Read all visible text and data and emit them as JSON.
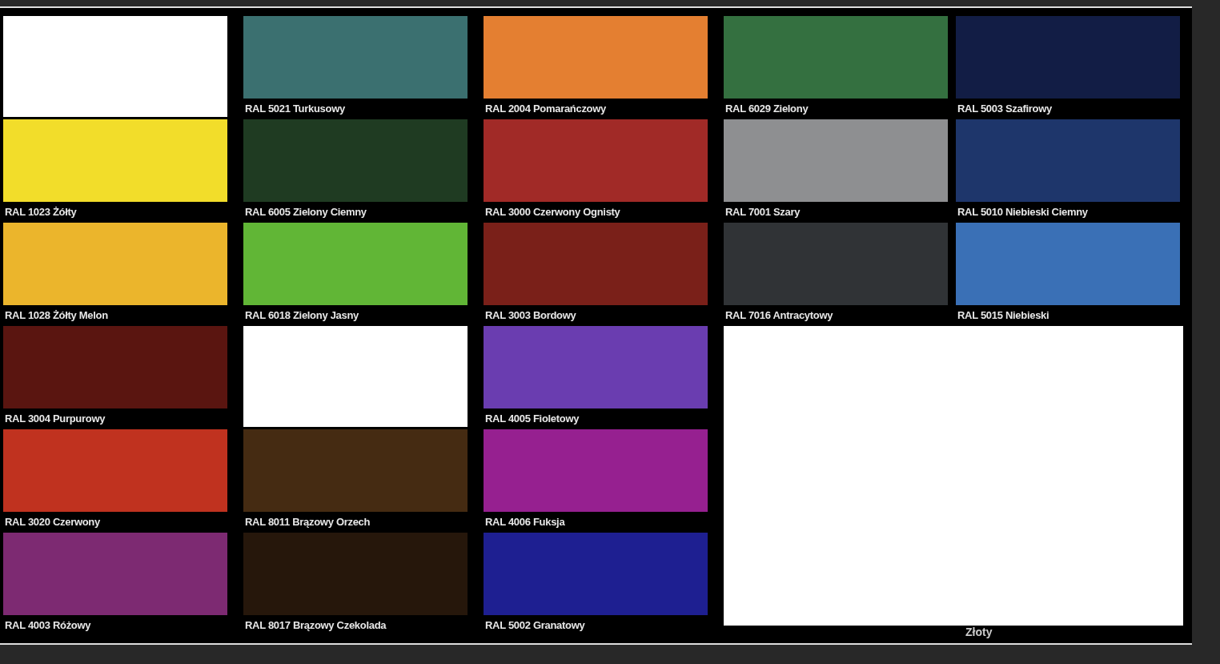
{
  "left_columns": [
    [
      {
        "kind": "blank"
      },
      {
        "kind": "swatch",
        "label": "RAL 1023 Żółty",
        "color": "#f2dd2a"
      },
      {
        "kind": "swatch",
        "label": "RAL 1028 Żółty Melon",
        "color": "#ebb52c"
      },
      {
        "kind": "swatch",
        "label": "RAL 3004 Purpurowy",
        "color": "#5a1510"
      },
      {
        "kind": "swatch",
        "label": "RAL 3020 Czerwony",
        "color": "#c0321f"
      },
      {
        "kind": "swatch",
        "label": "RAL 4003 Różowy",
        "color": "#7d2a72"
      }
    ],
    [
      {
        "kind": "swatch",
        "label": "RAL 5021 Turkusowy",
        "color": "#3b7070"
      },
      {
        "kind": "swatch",
        "label": "RAL 6005 Zielony Ciemny",
        "color": "#1f3b22"
      },
      {
        "kind": "swatch",
        "label": "RAL 6018 Zielony Jasny",
        "color": "#61b636"
      },
      {
        "kind": "blank"
      },
      {
        "kind": "swatch",
        "label": "RAL 8011 Brązowy Orzech",
        "color": "#452b12"
      },
      {
        "kind": "swatch",
        "label": "RAL 8017 Brązowy Czekolada",
        "color": "#26170b"
      }
    ],
    [
      {
        "kind": "swatch",
        "label": "RAL 2004 Pomarańczowy",
        "color": "#e47f31"
      },
      {
        "kind": "swatch",
        "label": "RAL 3000 Czerwony Ognisty",
        "color": "#a12a27"
      },
      {
        "kind": "swatch",
        "label": "RAL 3003 Bordowy",
        "color": "#7a2019"
      },
      {
        "kind": "swatch",
        "label": "RAL 4005 Fioletowy",
        "color": "#6a3db0"
      },
      {
        "kind": "swatch",
        "label": "RAL 4006 Fuksja",
        "color": "#962090"
      },
      {
        "kind": "swatch",
        "label": "RAL 5002 Granatowy",
        "color": "#1e1f91"
      }
    ]
  ],
  "right_columns": [
    [
      {
        "kind": "swatch",
        "label": "RAL 6029 Zielony",
        "color": "#347040"
      },
      {
        "kind": "swatch",
        "label": "RAL 7001 Szary",
        "color": "#8e8f91"
      },
      {
        "kind": "swatch",
        "label": "RAL 7016 Antracytowy",
        "color": "#303336"
      }
    ],
    [
      {
        "kind": "swatch",
        "label": "RAL 5003 Szafirowy",
        "color": "#121d45"
      },
      {
        "kind": "swatch",
        "label": "RAL 5010 Niebieski Ciemny",
        "color": "#1e366b"
      },
      {
        "kind": "swatch",
        "label": "RAL 5015 Niebieski",
        "color": "#3a70b6"
      }
    ]
  ],
  "covered_panel": {
    "visible_label": "Złoty"
  }
}
